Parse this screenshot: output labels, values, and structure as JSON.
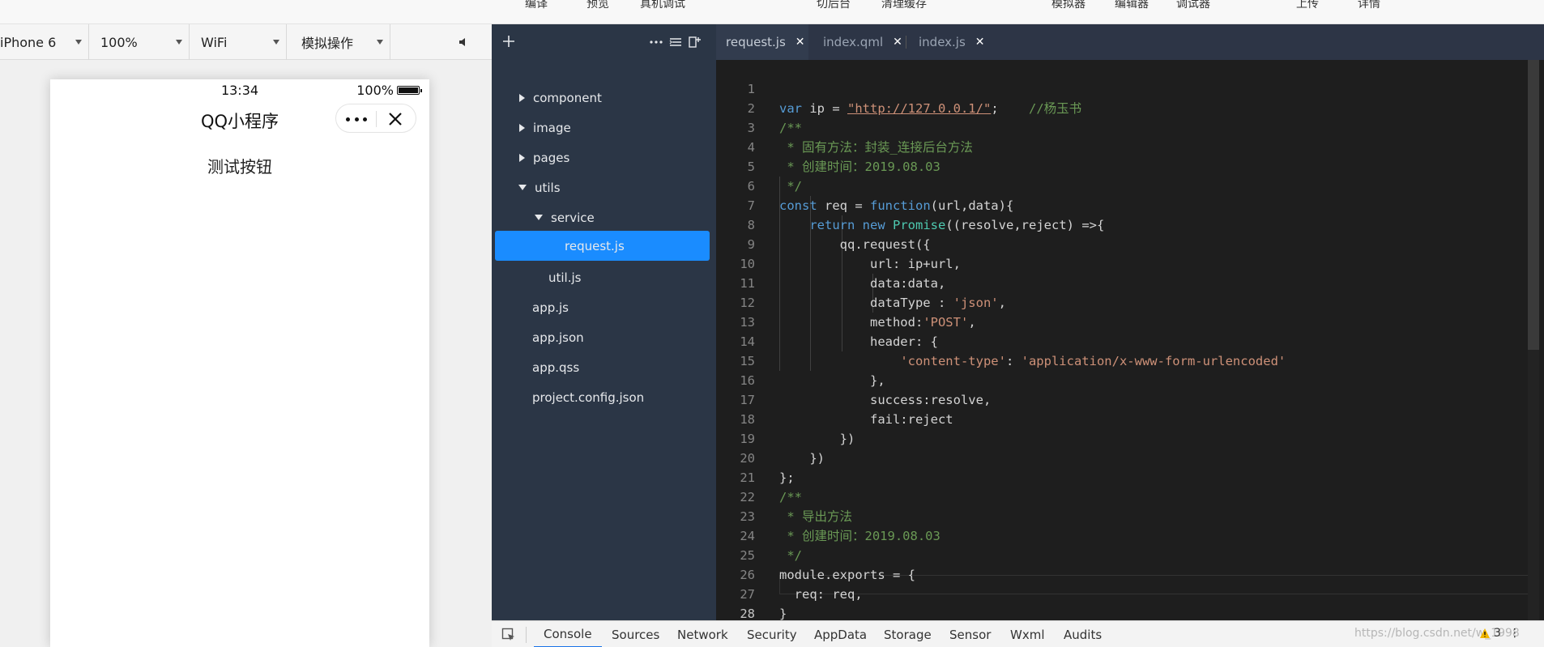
{
  "toolbar": {
    "items": [
      "编译",
      "预览",
      "真机调试",
      "切后台",
      "清理缓存",
      "模拟器",
      "编辑器",
      "调试器",
      "上传",
      "详情"
    ]
  },
  "simulator": {
    "device": "iPhone 6",
    "zoom": "100%",
    "network": "WiFi",
    "operation": "模拟操作",
    "status_time": "13:34",
    "battery": "100%",
    "nav_title": "QQ小程序",
    "test_button": "测试按钮"
  },
  "file_tree": {
    "items": [
      "component",
      "image",
      "pages",
      "utils",
      "service",
      "request.js",
      "util.js",
      "app.js",
      "app.json",
      "app.qss",
      "project.config.json"
    ]
  },
  "editor": {
    "tabs": [
      "request.js",
      "index.qml",
      "index.js"
    ],
    "lines": {
      "l1": {
        "kw": "var",
        "rest": " ip = ",
        "url": "\"http://127.0.0.1/\"",
        "semi": ";",
        "cm": "//杨玉书"
      },
      "l2": "/**",
      "l3": " * 固有方法：封装_连接后台方法",
      "l4": " * 创建时间：2019.08.03",
      "l5": " */",
      "l6": {
        "kw": "const",
        "a": " req = ",
        "fn": "function",
        "b": "(url,data){"
      },
      "l7": {
        "a": "return",
        "b": "new",
        "cls": "Promise",
        "c": "((resolve,reject) =>{"
      },
      "l8": "qq.request({",
      "l9": "url: ip+url,",
      "l10": "data:data,",
      "l11": {
        "a": "dataType : ",
        "str": "'json'",
        "b": ","
      },
      "l12": {
        "a": "method:",
        "str": "'POST'",
        "b": ","
      },
      "l13": "header: {",
      "l14": {
        "s1": "'content-type'",
        "a": ": ",
        "s2": "'application/x-www-form-urlencoded'"
      },
      "l15": "},",
      "l16": "success:resolve,",
      "l17": "fail:reject",
      "l18": "})",
      "l19": "})",
      "l20": "};",
      "l21": "/**",
      "l22": " * 导出方法",
      "l23": " * 创建时间：2019.08.03",
      "l24": " */",
      "l25": "module.exports = {",
      "l26": "  req: req,",
      "l27": "}"
    },
    "line_numbers": [
      "1",
      "2",
      "3",
      "4",
      "5",
      "6",
      "7",
      "8",
      "9",
      "10",
      "11",
      "12",
      "13",
      "14",
      "15",
      "16",
      "17",
      "18",
      "19",
      "20",
      "21",
      "22",
      "23",
      "24",
      "25",
      "26",
      "27",
      "28"
    ]
  },
  "devtools": {
    "tabs": [
      "Console",
      "Sources",
      "Network",
      "Security",
      "AppData",
      "Storage",
      "Sensor",
      "Wxml",
      "Audits"
    ],
    "watermark": "https://blog.csdn.net/w_1998",
    "warning_count": "3"
  },
  "colors": {
    "accent": "#1a8cff",
    "file_panel_bg": "#2b3646",
    "editor_bg": "#1e1e1e"
  }
}
